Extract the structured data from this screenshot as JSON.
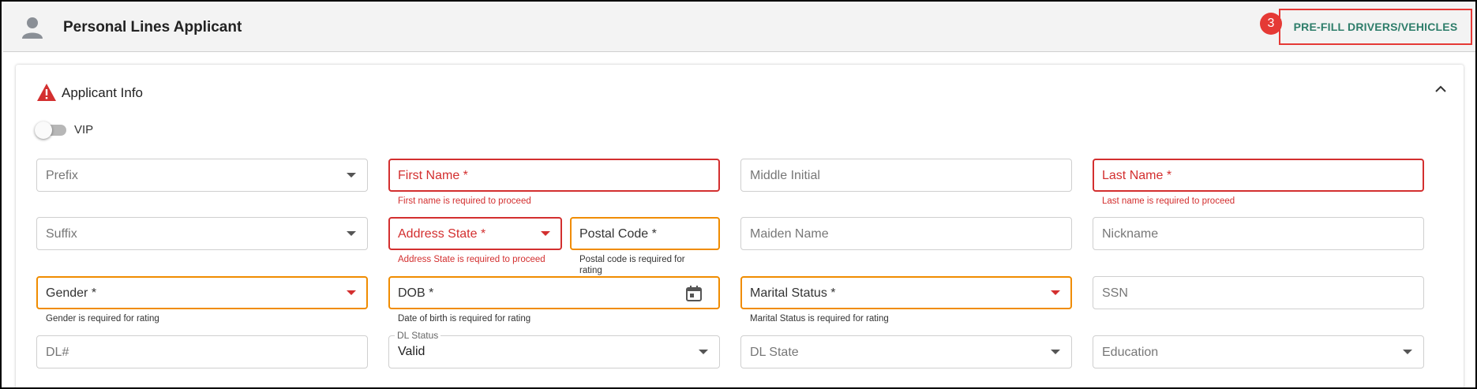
{
  "header": {
    "title": "Personal Lines Applicant",
    "icon": "person-icon",
    "step_badge": "3",
    "prefill_button": "PRE-FILL DRIVERS/VEHICLES"
  },
  "section": {
    "title": "Applicant Info",
    "status_icon": "warning-icon",
    "vip_label": "VIP",
    "vip_on": false
  },
  "fields": {
    "prefix": "Prefix",
    "first_name": "First Name *",
    "first_name_error": "First name is required to proceed",
    "middle_initial": "Middle Initial",
    "last_name": "Last Name *",
    "last_name_error": "Last name is required to proceed",
    "suffix": "Suffix",
    "address_state": "Address State *",
    "address_state_error": "Address State is required to proceed",
    "postal_code": "Postal Code *",
    "postal_code_hint": "Postal code is required for rating",
    "maiden_name": "Maiden Name",
    "nickname": "Nickname",
    "gender": "Gender *",
    "gender_hint": "Gender is required for rating",
    "dob": "DOB *",
    "dob_hint": "Date of birth is required for rating",
    "marital_status": "Marital Status *",
    "marital_status_hint": "Marital Status is required for rating",
    "ssn": "SSN",
    "dl_number": "DL#",
    "dl_status_label": "DL Status",
    "dl_status_value": "Valid",
    "dl_state": "DL State",
    "education": "Education"
  },
  "colors": {
    "error": "#d32f2f",
    "warning": "#f08c00",
    "accent": "#2e7d6a",
    "badge": "#e53935"
  }
}
